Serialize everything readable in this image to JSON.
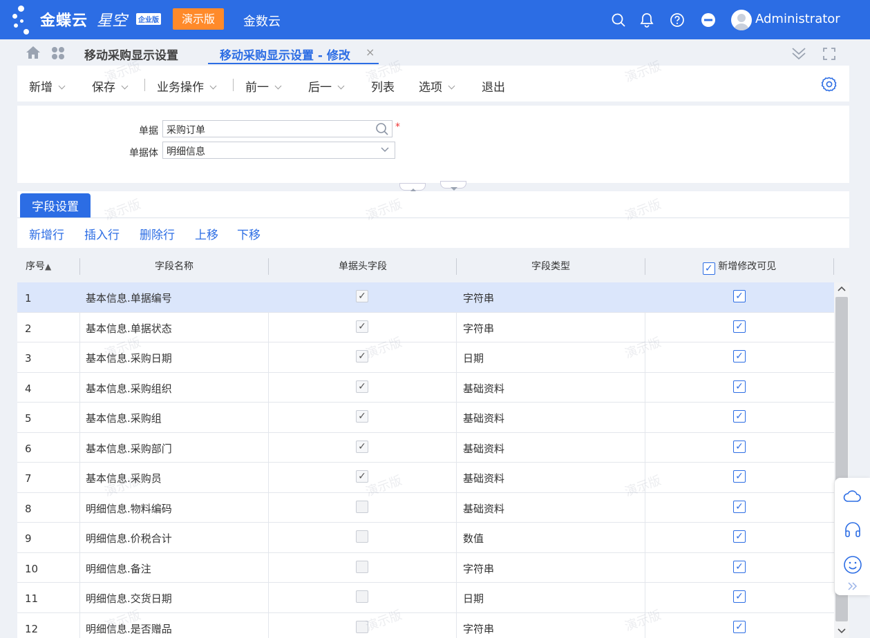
{
  "topbar": {
    "brand": "金蝶云",
    "brand_sub": "星空",
    "edition": "企业版",
    "demo_badge": "演示版",
    "cloud_name": "金数云",
    "user": "Administrator"
  },
  "tabs": [
    {
      "label": "移动采购显示设置"
    },
    {
      "label": "移动采购显示设置 - 修改",
      "close": "×"
    }
  ],
  "toolbar": {
    "items": [
      {
        "label": "新增"
      },
      {
        "label": "保存"
      },
      {
        "label": "业务操作"
      },
      {
        "label": "前一"
      },
      {
        "label": "后一"
      },
      {
        "label": "列表"
      },
      {
        "label": "选项"
      },
      {
        "label": "退出"
      }
    ]
  },
  "form": {
    "bill_label": "单据",
    "bill_value": "采购订单",
    "body_label": "单据体",
    "body_value": "明细信息",
    "required_mark": "*"
  },
  "section": {
    "tab": "字段设置",
    "actions": [
      "新增行",
      "插入行",
      "删除行",
      "上移",
      "下移"
    ]
  },
  "grid": {
    "columns": [
      "序号",
      "字段名称",
      "单据头字段",
      "字段类型",
      "新增修改可见"
    ],
    "sort_indicator": "▲",
    "header_checked": true,
    "rows": [
      {
        "no": "1",
        "name": "基本信息.单据编号",
        "header_field": true,
        "type": "字符串",
        "visible": true
      },
      {
        "no": "2",
        "name": "基本信息.单据状态",
        "header_field": true,
        "type": "字符串",
        "visible": true
      },
      {
        "no": "3",
        "name": "基本信息.采购日期",
        "header_field": true,
        "type": "日期",
        "visible": true
      },
      {
        "no": "4",
        "name": "基本信息.采购组织",
        "header_field": true,
        "type": "基础资料",
        "visible": true
      },
      {
        "no": "5",
        "name": "基本信息.采购组",
        "header_field": true,
        "type": "基础资料",
        "visible": true
      },
      {
        "no": "6",
        "name": "基本信息.采购部门",
        "header_field": true,
        "type": "基础资料",
        "visible": true
      },
      {
        "no": "7",
        "name": "基本信息.采购员",
        "header_field": true,
        "type": "基础资料",
        "visible": true
      },
      {
        "no": "8",
        "name": "明细信息.物料编码",
        "header_field": false,
        "type": "基础资料",
        "visible": true
      },
      {
        "no": "9",
        "name": "明细信息.价税合计",
        "header_field": false,
        "type": "数值",
        "visible": true
      },
      {
        "no": "10",
        "name": "明细信息.备注",
        "header_field": false,
        "type": "字符串",
        "visible": true
      },
      {
        "no": "11",
        "name": "明细信息.交货日期",
        "header_field": false,
        "type": "日期",
        "visible": true
      },
      {
        "no": "12",
        "name": "明细信息.是否赠品",
        "header_field": false,
        "type": "字符串",
        "visible": true
      }
    ]
  },
  "watermark": "演示版",
  "colors": {
    "brand": "#2c6de4",
    "demo_badge": "#ff8a2a",
    "selected_row": "#dbe6fb"
  },
  "icons": [
    "home-icon",
    "apps-icon",
    "search-icon",
    "bell-icon",
    "help-icon",
    "minus-circle-icon",
    "collapse-icon",
    "fullscreen-icon",
    "settings-icon",
    "cloud-icon",
    "headset-icon",
    "smile-icon",
    "double-chevron-icon"
  ]
}
